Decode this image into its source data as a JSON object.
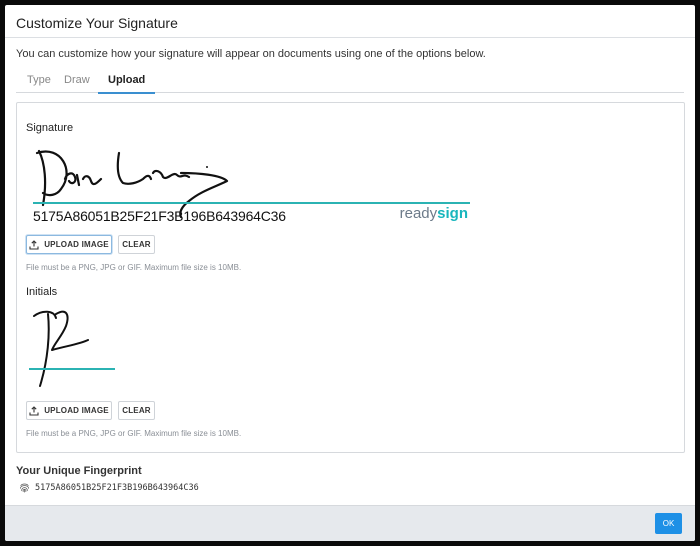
{
  "modal": {
    "title": "Customize Your Signature",
    "intro": "You can customize how your signature will appear on documents using one of the options below."
  },
  "tabs": [
    {
      "label": "Type",
      "active": false
    },
    {
      "label": "Draw",
      "active": false
    },
    {
      "label": "Upload",
      "active": true
    }
  ],
  "signature": {
    "label": "Signature",
    "hash": "5175A86051B25F21F3B196B643964C36",
    "brand_prefix": "ready",
    "brand_suffix": "sign",
    "upload_label": "UPLOAD IMAGE",
    "clear_label": "CLEAR",
    "hint": "File must be a PNG, JPG or GIF. Maximum file size is 10MB."
  },
  "initials": {
    "label": "Initials",
    "upload_label": "UPLOAD IMAGE",
    "clear_label": "CLEAR",
    "hint": "File must be a PNG, JPG or GIF. Maximum file size is 10MB."
  },
  "fingerprint": {
    "label": "Your Unique Fingerprint",
    "value": "5175A86051B25F21F3B196B643964C36",
    "icon": "fingerprint-icon"
  },
  "footer": {
    "ok_label": "OK"
  },
  "colors": {
    "accent": "#1e90e6",
    "signature_line": "#2bb3b3",
    "brand_sign": "#19b6bd"
  }
}
